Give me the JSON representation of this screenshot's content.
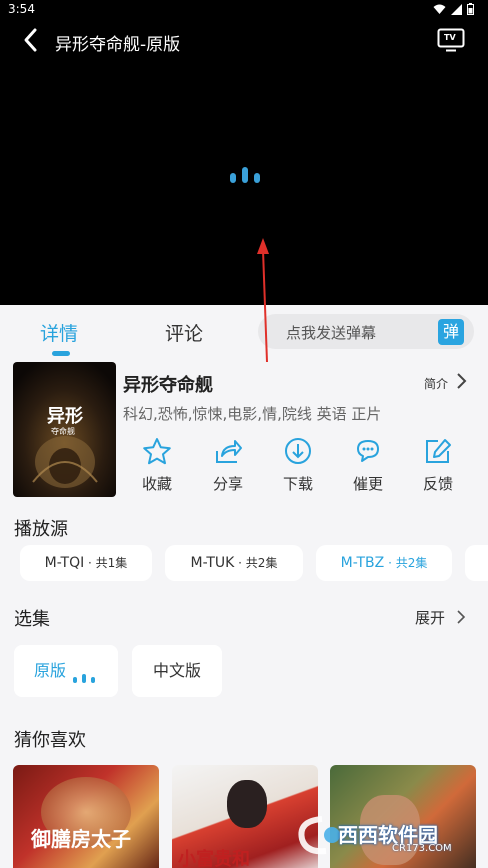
{
  "status": {
    "time": "3:54"
  },
  "header": {
    "title": "异形夺命舰-原版",
    "back_icon": "back-icon",
    "cast_icon": "tv-icon",
    "cast_label": "TV"
  },
  "tabs": [
    {
      "label": "详情"
    },
    {
      "label": "评论"
    }
  ],
  "danmu": {
    "placeholder": "点我发送弹幕",
    "button_label": "弹"
  },
  "movie": {
    "poster_title": "异形",
    "poster_sub": "夺命舰",
    "name": "异形夺命舰",
    "intro_label": "简介",
    "tags": "科幻,恐怖,惊悚,电影,情,院线 英语 正片"
  },
  "actions": [
    {
      "label": "收藏",
      "icon": "star-icon"
    },
    {
      "label": "分享",
      "icon": "share-icon"
    },
    {
      "label": "下载",
      "icon": "download-icon"
    },
    {
      "label": "催更",
      "icon": "urge-icon"
    },
    {
      "label": "反馈",
      "icon": "feedback-icon"
    }
  ],
  "sources": {
    "title": "播放源",
    "items": [
      {
        "name": "M-TQI",
        "count": " · 共1集"
      },
      {
        "name": "M-TUK",
        "count": " · 共2集"
      },
      {
        "name": "M-TBZ",
        "count": " · 共2集"
      }
    ]
  },
  "episodes": {
    "title": "选集",
    "expand_label": "展开",
    "items": [
      {
        "label": "原版"
      },
      {
        "label": "中文版"
      }
    ]
  },
  "recommend": {
    "title": "猜你喜欢",
    "items": [
      {
        "caption": "御膳房太子"
      },
      {
        "caption": "小富贵和"
      },
      {
        "caption": ""
      }
    ]
  },
  "watermark": {
    "text": "西西软件园",
    "sub": "CR173.COM"
  },
  "colors": {
    "accent": "#29a3dd",
    "player_bg": "#000000",
    "sheet_bg": "#f5f5f7",
    "arrow": "#e0302a"
  }
}
